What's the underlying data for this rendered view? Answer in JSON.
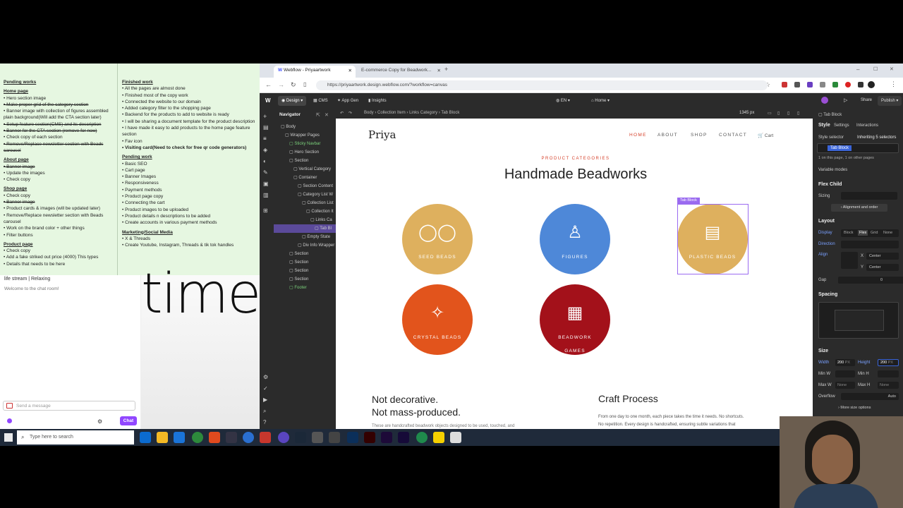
{
  "notes": {
    "left_col": [
      {
        "t": "Pending works",
        "cls": "h first"
      },
      {
        "t": " ",
        "cls": ""
      },
      {
        "t": "Home page",
        "cls": "h"
      },
      {
        "t": "• Hero section image",
        "cls": ""
      },
      {
        "t": "• Make proper grid of the category section",
        "cls": "st"
      },
      {
        "t": "• Banner image with collection of figures assembled plain background(Will add the CTA section later)",
        "cls": ""
      },
      {
        "t": "• Setup feature section(CMS) and its description",
        "cls": "st"
      },
      {
        "t": "• Banner for the CTA section (remove for now)",
        "cls": "st"
      },
      {
        "t": "• Check copy of each section",
        "cls": ""
      },
      {
        "t": "• Remove/Replace newsletter section with Beads carousel",
        "cls": "st"
      },
      {
        "t": "About page",
        "cls": "h"
      },
      {
        "t": "• Banner image",
        "cls": "st"
      },
      {
        "t": "• Update the images",
        "cls": ""
      },
      {
        "t": "• Check copy",
        "cls": ""
      },
      {
        "t": "Shop page",
        "cls": "h"
      },
      {
        "t": "• Check copy",
        "cls": ""
      },
      {
        "t": "• Banner image",
        "cls": "st"
      },
      {
        "t": "• Product cards & images (will be updated later)",
        "cls": ""
      },
      {
        "t": "• Remove/Replace newsletter section with Beads carousel",
        "cls": ""
      },
      {
        "t": "• Work on the brand color + other things",
        "cls": ""
      },
      {
        "t": "• Filter buttons",
        "cls": ""
      },
      {
        "t": "Product page",
        "cls": "h"
      },
      {
        "t": "• Check copy",
        "cls": ""
      },
      {
        "t": "• Add a fake striked out price (4000) This types",
        "cls": ""
      },
      {
        "t": "• Details that needs to be here",
        "cls": ""
      }
    ],
    "right_col": [
      {
        "t": "Finished work",
        "cls": "h first"
      },
      {
        "t": "• All the pages are almost done",
        "cls": ""
      },
      {
        "t": "• Finished most of the copy work",
        "cls": ""
      },
      {
        "t": "• Connected the website to our domain",
        "cls": ""
      },
      {
        "t": "• Added category filter to the shopping page",
        "cls": ""
      },
      {
        "t": "• Backend for the products to add to website is ready",
        "cls": ""
      },
      {
        "t": "• I will be sharing a document template for the product description",
        "cls": ""
      },
      {
        "t": "• I have made it easy to add products to the home page feature section",
        "cls": ""
      },
      {
        "t": "• Fav icon",
        "cls": ""
      },
      {
        "t": "• Visiting card(Need to check for free qr code generators)",
        "cls": "b"
      },
      {
        "t": " ",
        "cls": ""
      },
      {
        "t": "Pending work",
        "cls": "h"
      },
      {
        "t": "• Basic SEO",
        "cls": ""
      },
      {
        "t": "• Cart page",
        "cls": ""
      },
      {
        "t": "• Banner Images",
        "cls": ""
      },
      {
        "t": "• Responsiveness",
        "cls": ""
      },
      {
        "t": "• Payment methods",
        "cls": ""
      },
      {
        "t": "• Product page copy",
        "cls": ""
      },
      {
        "t": "• Connecting the cart",
        "cls": ""
      },
      {
        "t": "• Product images to be uploaded",
        "cls": ""
      },
      {
        "t": "• Product details n descriptions to be added",
        "cls": ""
      },
      {
        "t": "• Create accounts in various payment methods",
        "cls": ""
      },
      {
        "t": " ",
        "cls": ""
      },
      {
        "t": "Marketing/Social Media",
        "cls": "h"
      },
      {
        "t": "• X & Threads",
        "cls": ""
      },
      {
        "t": "• Create Youtube, Instagram, Threads & tik tok handles",
        "cls": ""
      }
    ]
  },
  "stream": {
    "title": "life stream | Relaxing",
    "welcome": "Welcome to the chat room!",
    "placeholder": "Send a message",
    "chat_label": "Chat",
    "bg_word": "time"
  },
  "browser": {
    "tab1": "Webflow - Priyaartwork",
    "tab2": "E-commerce Copy for Beadwork...",
    "url": "https://priyaartwork.design.webflow.com/?workflow=canvas"
  },
  "wf": {
    "mode": "Design",
    "cms": "CMS",
    "appgen": "App Gen",
    "insights": "Insights",
    "locale": "EN",
    "page": "Home",
    "share": "Share",
    "publish": "Publish",
    "navigator": "Navigator",
    "width": "1345 px",
    "crumbs": [
      "Body",
      "Collection Item",
      "Links Category",
      "Tab Block"
    ]
  },
  "nav_tree": [
    {
      "t": "Body",
      "ind": 0,
      "c": ""
    },
    {
      "t": "Wrapper Pages",
      "ind": 1,
      "c": ""
    },
    {
      "t": "Sticky Navbar",
      "ind": 2,
      "c": "g"
    },
    {
      "t": "Hero Section",
      "ind": 2,
      "c": ""
    },
    {
      "t": "Section",
      "ind": 2,
      "c": ""
    },
    {
      "t": "Vertical Category",
      "ind": 3,
      "c": ""
    },
    {
      "t": "Container",
      "ind": 3,
      "c": ""
    },
    {
      "t": "Section Content",
      "ind": 4,
      "c": ""
    },
    {
      "t": "Category List W",
      "ind": 4,
      "c": ""
    },
    {
      "t": "Collection List",
      "ind": 5,
      "c": ""
    },
    {
      "t": "Collection It",
      "ind": 6,
      "c": ""
    },
    {
      "t": "Links Ca",
      "ind": 7,
      "c": ""
    },
    {
      "t": "Tab Bl",
      "ind": 8,
      "c": "sel"
    },
    {
      "t": "Empty State",
      "ind": 5,
      "c": ""
    },
    {
      "t": "Div Info Wrapper",
      "ind": 4,
      "c": ""
    },
    {
      "t": "Section",
      "ind": 2,
      "c": ""
    },
    {
      "t": "Section",
      "ind": 2,
      "c": ""
    },
    {
      "t": "Section",
      "ind": 2,
      "c": ""
    },
    {
      "t": "Section",
      "ind": 2,
      "c": ""
    },
    {
      "t": "Footer",
      "ind": 2,
      "c": "g"
    }
  ],
  "site": {
    "logo": "Priya",
    "nav": [
      "HOME",
      "ABOUT",
      "SHOP",
      "CONTACT"
    ],
    "cart": "Cart",
    "eyebrow": "PRODUCT CATEGORIES",
    "heading": "Handmade Beadworks",
    "categories": [
      {
        "label": "SEED BEADS",
        "color": "#deb05e",
        "icon": "seed-beads-icon"
      },
      {
        "label": "FIGURES",
        "color": "#4e88d8",
        "icon": "figure-icon"
      },
      {
        "label": "PLASTIC BEADS",
        "color": "#deb05e",
        "icon": "plastic-beads-icon"
      },
      {
        "label": "CRYSTAL BEADS",
        "color": "#e2541c",
        "icon": "crystal-icon"
      },
      {
        "label": "BEADWORK GAMES",
        "color": "#a3111a",
        "icon": "games-icon"
      }
    ],
    "tab_block_tag": "Tab Block",
    "left_title_1": "Not decorative.",
    "left_title_2": "Not mass-produced.",
    "left_text": "These are handcrafted beadwork objects designed to be used, touched, and",
    "right_title": "Craft Process",
    "right_text_1": "From one day to one month, each piece takes the time it needs. No shortcuts.",
    "right_text_2": "No repetition. Every design is handcrafted, ensuring subtle variations that"
  },
  "panel": {
    "tabs": [
      "Style",
      "Settings",
      "Interactions"
    ],
    "element": "Tab Block",
    "selector_label": "Style selector",
    "inheriting": "Inheriting 5 selectors",
    "class_name": "Tab Block",
    "on_page": "1 on this page, 1 on other pages",
    "variable_modes": "Variable modes",
    "flex_child": "Flex Child",
    "sizing": "Sizing",
    "align_order": "Alignment and order",
    "layout": "Layout",
    "display": "Display",
    "display_opts": [
      "Block",
      "Flex",
      "Grid",
      "None"
    ],
    "direction": "Direction",
    "align": "Align",
    "x_val": "Center",
    "y_val": "Center",
    "gap": "Gap",
    "gap_val": "0",
    "spacing": "Spacing",
    "size": "Size",
    "width_label": "Width",
    "width_val": "200",
    "height_label": "Height",
    "height_val": "200",
    "min_w": "Min W",
    "min_h": "Min H",
    "max_w": "Max W",
    "max_h": "Max H",
    "none": "None",
    "overflow": "Overflow",
    "auto": "Auto",
    "more_size": "More size options",
    "px": "PX"
  },
  "taskbar": {
    "search_placeholder": "Type here to search"
  }
}
